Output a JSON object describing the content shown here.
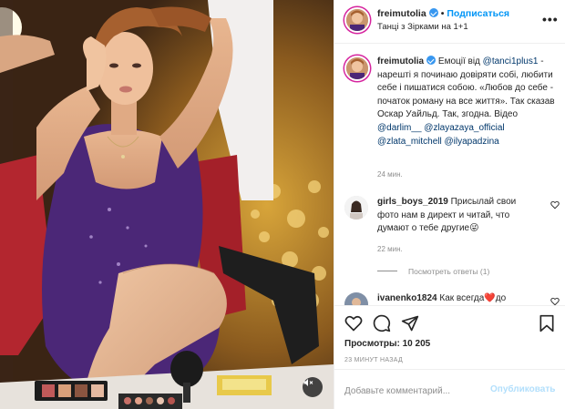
{
  "post": {
    "username": "freimutolia",
    "follow_label": "Подписаться",
    "dot": "•",
    "subtitle": "Танці з Зірками на 1+1",
    "more_label": "•••"
  },
  "caption": {
    "username": "freimutolia",
    "parts": [
      {
        "text": " Емоції від ",
        "type": "text"
      },
      {
        "text": "@tanci1plus1",
        "type": "mention"
      },
      {
        "text": " - нарешті я починаю довіряти собі, любити себе і пишатися собою. «Любов до себе - початок роману на все життя». Так сказав Оскар Уайльд. Так, згодна. Відео ",
        "type": "text"
      },
      {
        "text": "@darlim__",
        "type": "mention"
      },
      {
        "text": " ",
        "type": "text"
      },
      {
        "text": "@zlayazaya_official",
        "type": "mention"
      },
      {
        "text": " ",
        "type": "text"
      },
      {
        "text": "@zlata_mitchell",
        "type": "mention"
      },
      {
        "text": " ",
        "type": "text"
      },
      {
        "text": "@ilyapadzina",
        "type": "mention"
      }
    ],
    "time": "24 мин."
  },
  "comments": [
    {
      "username": "girls_boys_2019",
      "text": " Присылай свои фото нам в директ и читай, что думают о тебе другие😜",
      "time": "22 мин.",
      "replies_label": "Посмотреть ответы (1)"
    },
    {
      "username": "ivanenko1824",
      "text": " Как всегда❤️до",
      "time": ""
    }
  ],
  "actions": {
    "views": "Просмотры: 10 205",
    "ago": "23 МИНУТ НАЗАД"
  },
  "add_comment": {
    "placeholder": "Добавьте комментарий...",
    "publish_label": "Опубликовать"
  },
  "colors": {
    "accent": "#0095f6",
    "mention": "#00376b",
    "muted": "#8e8e8e",
    "dress": "#4b2777",
    "heart": "#ed4956"
  },
  "icons": [
    "verified-badge-icon",
    "more-options-icon",
    "heart-icon",
    "comment-icon",
    "share-icon",
    "bookmark-icon",
    "mute-icon"
  ]
}
